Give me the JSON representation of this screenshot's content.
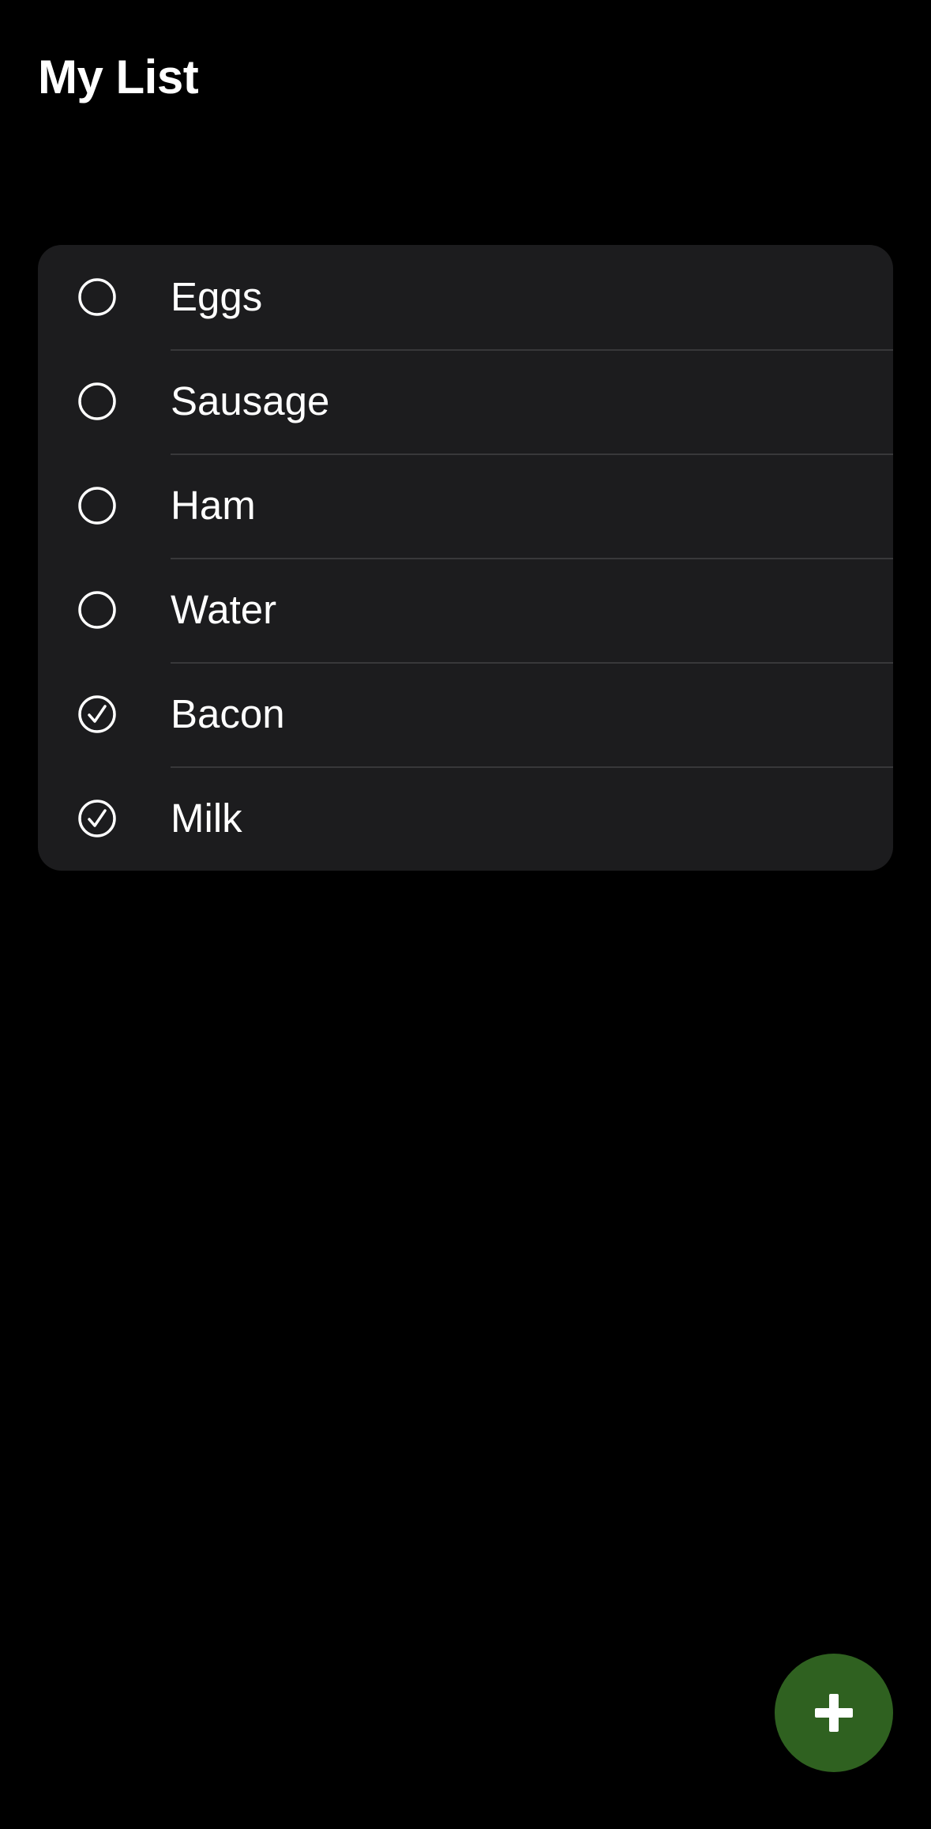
{
  "header": {
    "title": "My List"
  },
  "list": {
    "items": [
      {
        "label": "Eggs",
        "checked": false
      },
      {
        "label": "Sausage",
        "checked": false
      },
      {
        "label": "Ham",
        "checked": false
      },
      {
        "label": "Water",
        "checked": false
      },
      {
        "label": "Bacon",
        "checked": true
      },
      {
        "label": "Milk",
        "checked": true
      }
    ]
  },
  "fab": {
    "icon": "plus-icon",
    "color": "#2f6120"
  },
  "colors": {
    "background": "#000000",
    "card": "#1c1c1e",
    "separator": "#38383a",
    "text": "#ffffff"
  }
}
